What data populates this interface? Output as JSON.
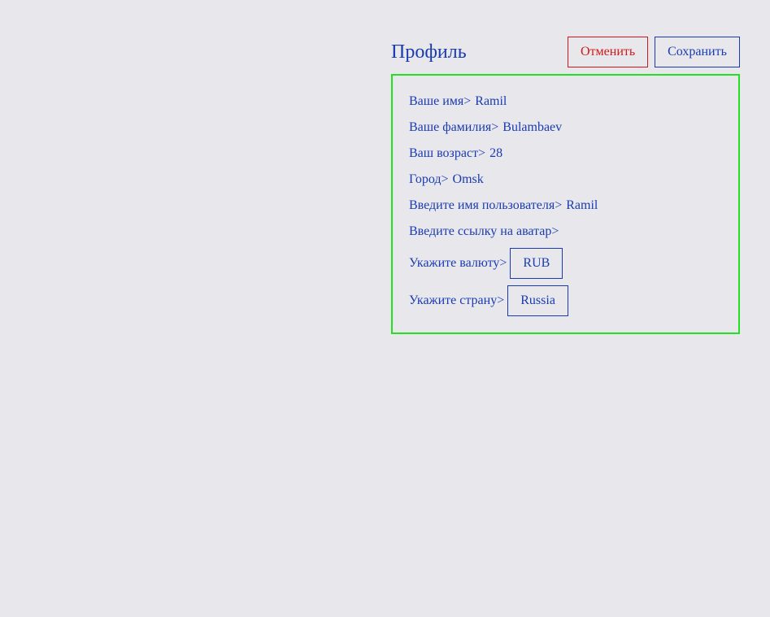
{
  "header": {
    "title": "Профиль",
    "cancel_label": "Отменить",
    "save_label": "Сохранить"
  },
  "profile": {
    "first_name": {
      "label": "Ваше имя>",
      "value": "Ramil"
    },
    "last_name": {
      "label": "Ваше фамилия>",
      "value": "Bulambaev"
    },
    "age": {
      "label": "Ваш возраст>",
      "value": "28"
    },
    "city": {
      "label": "Город>",
      "value": "Omsk"
    },
    "username": {
      "label": "Введите имя пользователя>",
      "value": "Ramil"
    },
    "avatar": {
      "label": "Введите ссылку на аватар>",
      "value": ""
    },
    "currency": {
      "label": "Укажите валюту>",
      "value": "RUB"
    },
    "country": {
      "label": "Укажите страну>",
      "value": "Russia"
    }
  },
  "colors": {
    "background": "#e8e8ec",
    "text": "#1a3bb0",
    "cancel": "#d01818",
    "card_border": "#22e022"
  }
}
